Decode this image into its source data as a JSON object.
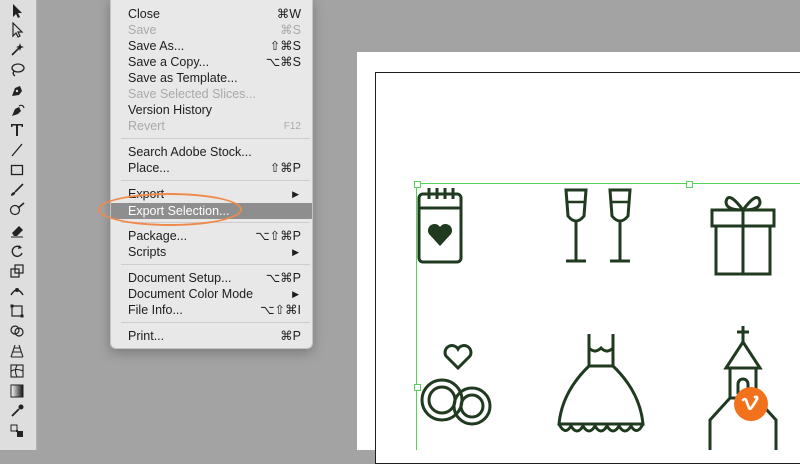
{
  "menu": {
    "items": [
      {
        "label": "Close",
        "shortcut": "⌘W",
        "disabled": false
      },
      {
        "label": "Save",
        "shortcut": "⌘S",
        "disabled": true
      },
      {
        "label": "Save As...",
        "shortcut": "⇧⌘S",
        "disabled": false
      },
      {
        "label": "Save a Copy...",
        "shortcut": "⌥⌘S",
        "disabled": false
      },
      {
        "label": "Save as Template...",
        "shortcut": "",
        "disabled": false
      },
      {
        "label": "Save Selected Slices...",
        "shortcut": "",
        "disabled": true
      },
      {
        "label": "Version History",
        "shortcut": "",
        "disabled": false
      },
      {
        "label": "Revert",
        "shortcut": "F12",
        "disabled": true
      },
      {
        "label": "Search Adobe Stock...",
        "shortcut": "",
        "disabled": false
      },
      {
        "label": "Place...",
        "shortcut": "⇧⌘P",
        "disabled": false
      },
      {
        "label": "Export",
        "shortcut": "",
        "submenu": true,
        "disabled": false
      },
      {
        "label": "Export Selection...",
        "shortcut": "",
        "disabled": false,
        "highlighted": true
      },
      {
        "label": "Package...",
        "shortcut": "⌥⇧⌘P",
        "disabled": false
      },
      {
        "label": "Scripts",
        "shortcut": "",
        "submenu": true,
        "disabled": false
      },
      {
        "label": "Document Setup...",
        "shortcut": "⌥⌘P",
        "disabled": false
      },
      {
        "label": "Document Color Mode",
        "shortcut": "",
        "submenu": true,
        "disabled": false
      },
      {
        "label": "File Info...",
        "shortcut": "⌥⇧⌘I",
        "disabled": false
      },
      {
        "label": "Print...",
        "shortcut": "⌘P",
        "disabled": false
      }
    ],
    "submenu_arrow": "▶"
  },
  "colors": {
    "canvas_bg": "#a3a3a3",
    "menu_bg": "#e8e8e8",
    "highlight": "#8e8e8e",
    "callout": "#f08a4b",
    "selection": "#58d158",
    "badge": "#f2711c"
  },
  "toolbar_icons": [
    "selection-tool-icon",
    "direct-selection-tool-icon",
    "magic-wand-icon",
    "lasso-icon",
    "pen-tool-icon",
    "curvature-tool-icon",
    "type-tool-icon",
    "line-tool-icon",
    "rectangle-tool-icon",
    "paintbrush-icon",
    "shaper-tool-icon",
    "eraser-icon",
    "rotate-tool-icon",
    "scale-tool-icon",
    "width-tool-icon",
    "free-transform-icon",
    "shape-builder-icon",
    "perspective-grid-icon",
    "mesh-tool-icon",
    "gradient-tool-icon",
    "eyedropper-icon",
    "blend-tool-icon"
  ],
  "artwork_icons": [
    "calendar-heart-icon",
    "champagne-glasses-icon",
    "gift-box-icon",
    "rings-heart-icon",
    "wedding-dress-icon",
    "chapel-icon"
  ]
}
